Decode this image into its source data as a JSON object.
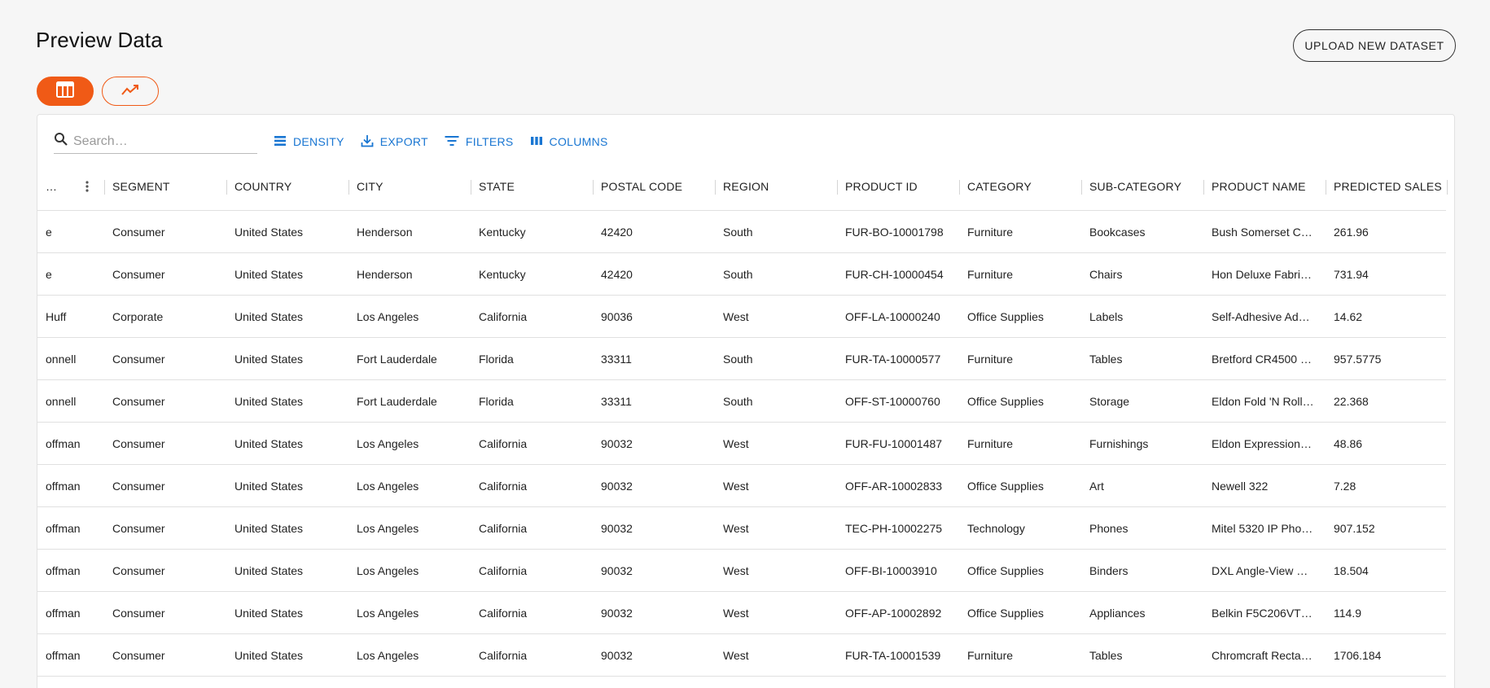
{
  "page": {
    "title": "Preview Data",
    "upload_label": "UPLOAD NEW DATASET"
  },
  "view_toggle": {
    "table_icon": "table-icon",
    "chart_icon": "trend-line-icon",
    "accent": "#f05a16"
  },
  "toolbar": {
    "search_placeholder": "Search…",
    "search_value": "",
    "density_label": "DENSITY",
    "export_label": "EXPORT",
    "filters_label": "FILTERS",
    "columns_label": "COLUMNS",
    "link_color": "#1976d2"
  },
  "table": {
    "columns": [
      "…",
      "SEGMENT",
      "COUNTRY",
      "CITY",
      "STATE",
      "POSTAL CODE",
      "REGION",
      "PRODUCT ID",
      "CATEGORY",
      "SUB-CATEGORY",
      "PRODUCT NAME",
      "PREDICTED SALES"
    ],
    "rows": [
      [
        "e",
        "Consumer",
        "United States",
        "Henderson",
        "Kentucky",
        "42420",
        "South",
        "FUR-BO-10001798",
        "Furniture",
        "Bookcases",
        "Bush Somerset C…",
        "261.96"
      ],
      [
        "e",
        "Consumer",
        "United States",
        "Henderson",
        "Kentucky",
        "42420",
        "South",
        "FUR-CH-10000454",
        "Furniture",
        "Chairs",
        "Hon Deluxe Fabri…",
        "731.94"
      ],
      [
        " Huff",
        "Corporate",
        "United States",
        "Los Angeles",
        "California",
        "90036",
        "West",
        "OFF-LA-10000240",
        "Office Supplies",
        "Labels",
        "Self-Adhesive Ad…",
        "14.62"
      ],
      [
        "onnell",
        "Consumer",
        "United States",
        "Fort Lauderdale",
        "Florida",
        "33311",
        "South",
        "FUR-TA-10000577",
        "Furniture",
        "Tables",
        "Bretford CR4500 …",
        "957.5775"
      ],
      [
        "onnell",
        "Consumer",
        "United States",
        "Fort Lauderdale",
        "Florida",
        "33311",
        "South",
        "OFF-ST-10000760",
        "Office Supplies",
        "Storage",
        "Eldon Fold 'N Roll…",
        "22.368"
      ],
      [
        "offman",
        "Consumer",
        "United States",
        "Los Angeles",
        "California",
        "90032",
        "West",
        "FUR-FU-10001487",
        "Furniture",
        "Furnishings",
        "Eldon Expression…",
        "48.86"
      ],
      [
        "offman",
        "Consumer",
        "United States",
        "Los Angeles",
        "California",
        "90032",
        "West",
        "OFF-AR-10002833",
        "Office Supplies",
        "Art",
        "Newell 322",
        "7.28"
      ],
      [
        "offman",
        "Consumer",
        "United States",
        "Los Angeles",
        "California",
        "90032",
        "West",
        "TEC-PH-10002275",
        "Technology",
        "Phones",
        "Mitel 5320 IP Pho…",
        "907.152"
      ],
      [
        "offman",
        "Consumer",
        "United States",
        "Los Angeles",
        "California",
        "90032",
        "West",
        "OFF-BI-10003910",
        "Office Supplies",
        "Binders",
        "DXL Angle-View …",
        "18.504"
      ],
      [
        "offman",
        "Consumer",
        "United States",
        "Los Angeles",
        "California",
        "90032",
        "West",
        "OFF-AP-10002892",
        "Office Supplies",
        "Appliances",
        "Belkin F5C206VT…",
        "114.9"
      ],
      [
        "offman",
        "Consumer",
        "United States",
        "Los Angeles",
        "California",
        "90032",
        "West",
        "FUR-TA-10001539",
        "Furniture",
        "Tables",
        "Chromcraft Recta…",
        "1706.184"
      ]
    ]
  }
}
